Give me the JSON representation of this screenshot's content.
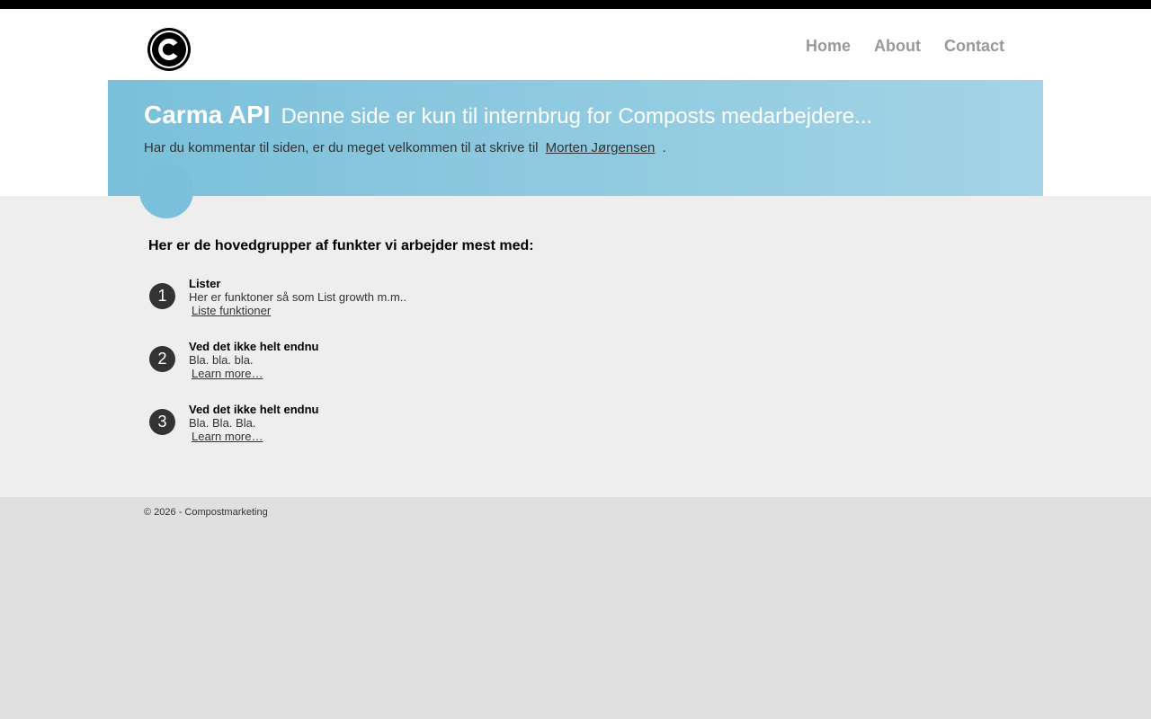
{
  "nav": {
    "items": [
      "Home",
      "About",
      "Contact"
    ]
  },
  "hero": {
    "title": "Carma API",
    "subtitle": "Denne side er kun til internbrug for Composts medarbejdere...",
    "text": "Har du kommentar til siden, er du meget velkommen til at skrive til",
    "link": "Morten Jørgensen",
    "period": "."
  },
  "main": {
    "heading": "Her er de hovedgrupper af funkter vi arbejder mest med:",
    "features": [
      {
        "num": "1",
        "title": "Lister",
        "desc": "Her er funktoner så som List growth m.m..",
        "link": "Liste funktioner"
      },
      {
        "num": "2",
        "title": "Ved det ikke helt endnu",
        "desc": "Bla. bla. bla.",
        "link": "Learn more…"
      },
      {
        "num": "3",
        "title": "Ved det ikke helt endnu",
        "desc": "Bla. Bla. Bla.",
        "link": "Learn more…"
      }
    ]
  },
  "footer": {
    "copyright": "© 2026 - Compostmarketing"
  },
  "colors": {
    "accent": "#7ac0da",
    "nav_text": "#999999"
  },
  "icons": {
    "logo": "copyright-c-logo-icon"
  }
}
